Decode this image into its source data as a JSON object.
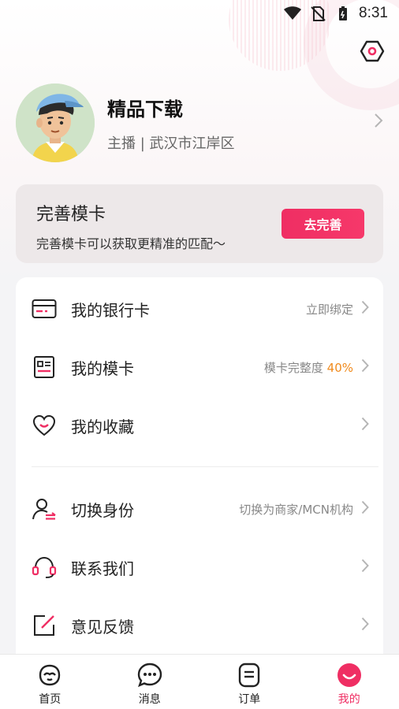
{
  "status_bar": {
    "time": "8:31",
    "icons": [
      "wifi-icon",
      "no-sim-icon",
      "battery-icon"
    ]
  },
  "settings": {
    "icon": "settings-hexagon-icon"
  },
  "profile": {
    "name": "精品下载",
    "subtitle": "主播 | 武汉市江岸区"
  },
  "prompt": {
    "title": "完善模卡",
    "description": "完善模卡可以获取更精准的匹配～",
    "button_label": "去完善"
  },
  "menu": {
    "items": [
      {
        "label": "我的银行卡",
        "hint": "立即绑定",
        "icon": "bank-card-icon"
      },
      {
        "label": "我的模卡",
        "hint": "模卡完整度",
        "accent": "40%",
        "icon": "model-card-icon"
      },
      {
        "label": "我的收藏",
        "hint": "",
        "icon": "heart-icon"
      },
      {
        "label": "切换身份",
        "hint": "切换为商家/MCN机构",
        "icon": "switch-identity-icon"
      },
      {
        "label": "联系我们",
        "hint": "",
        "icon": "headset-icon"
      },
      {
        "label": "意见反馈",
        "hint": "",
        "icon": "feedback-edit-icon"
      }
    ]
  },
  "bottom_nav": {
    "items": [
      {
        "label": "首页",
        "icon": "home-face-icon",
        "active": false
      },
      {
        "label": "消息",
        "icon": "message-bubble-icon",
        "active": false
      },
      {
        "label": "订单",
        "icon": "order-list-icon",
        "active": false
      },
      {
        "label": "我的",
        "icon": "profile-smile-icon",
        "active": true
      }
    ]
  },
  "colors": {
    "accent": "#ef2e63",
    "highlight": "#f08a1c"
  }
}
